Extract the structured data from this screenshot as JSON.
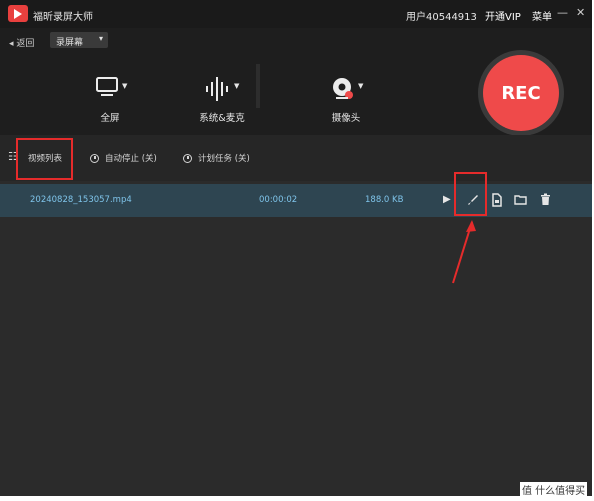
{
  "titlebar": {
    "app_title": "福昕录屏大师",
    "user": "用户40544913",
    "vip": "开通VIP",
    "menu": "菜单",
    "minimize": "—",
    "close": "✕"
  },
  "toolbar": {
    "back": "◂ 返回",
    "mode": "录屏幕",
    "mode_caret": "▾",
    "sources": [
      {
        "label": "全屏"
      },
      {
        "label": "系统&麦克"
      },
      {
        "label": "摄像头"
      }
    ],
    "rec_label": "REC"
  },
  "tabs": {
    "list_icon": "☷",
    "video_list": "视频列表",
    "auto_stop": "自动停止 (关)",
    "schedule": "计划任务 (关)"
  },
  "file_row": {
    "name": "20240828_153057.mp4",
    "duration": "00:00:02",
    "size": "188.0 KB",
    "play_icon": "▶"
  },
  "watermark": "值 什么值得买",
  "colors": {
    "accent_red": "#ef4a4a",
    "highlight_red": "#e52b2b",
    "row_text": "#7fc4ea",
    "row_bg": "#2e4551"
  }
}
